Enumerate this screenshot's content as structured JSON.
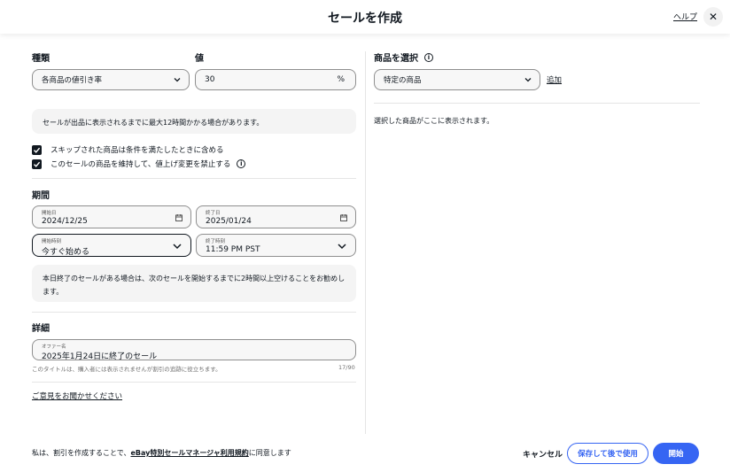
{
  "header": {
    "title": "セールを作成",
    "help_label": "ヘルプ",
    "close_label": "✕"
  },
  "left": {
    "type_label": "種類",
    "type_select": "各商品の値引き率",
    "value_label": "値",
    "value_input": "30",
    "value_suffix": "%",
    "notice": "セールが出品に表示されるまでに最大12時間かかる場合があります。",
    "check1": "スキップされた商品は条件を満たしたときに含める",
    "check2": "このセールの商品を維持して、値上げ変更を禁止する",
    "period_heading": "期間",
    "start_date_label": "開始日",
    "start_date_value": "2024/12/25",
    "end_date_label": "終了日",
    "end_date_value": "2025/01/24",
    "start_time_label": "開始時刻",
    "start_time_value": "今すぐ始める",
    "end_time_label": "終了時刻",
    "end_time_value": "11:59 PM PST",
    "period_notice": "本日終了のセールがある場合は、次のセールを開始するまでに2時間以上空けることをお勧めします。",
    "details_heading": "詳細",
    "offer_name_label": "オファー名",
    "offer_name_value": "2025年1月24日に終了のセール",
    "offer_helper": "このタイトルは、購入者には表示されませんが割引の追跡に役立ちます。",
    "offer_count": "17/90",
    "feedback_link": "ご意見をお聞かせください"
  },
  "right": {
    "select_heading": "商品を選択",
    "item_select": "特定の商品",
    "add_link": "追加",
    "empty_text": "選択した商品がここに表示されます。"
  },
  "footer": {
    "terms_prefix": "私は、割引を作成することで、",
    "terms_link": "eBay特別セールマネージャ利用規約",
    "terms_suffix": "に同意します",
    "cancel_label": "キャンセル",
    "save_label": "保存して後で使用",
    "start_label": "開始"
  },
  "colors": {
    "primary": "#3665f3",
    "text": "#111820"
  }
}
